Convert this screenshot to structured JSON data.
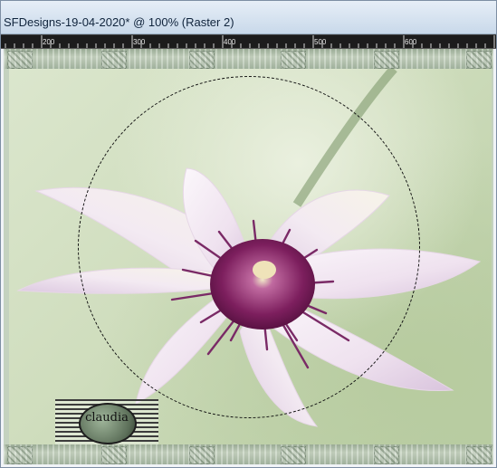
{
  "window": {
    "title": "SFDesigns-19-04-2020* @ 100% (Raster 2)"
  },
  "ruler": {
    "ticks": [
      "200",
      "300",
      "400",
      "500",
      "600"
    ]
  },
  "canvas": {
    "watermark_text": "claudia"
  },
  "colors": {
    "titlebar": "#c9d9ea",
    "ruler_bg": "#1c1c1c",
    "frame_border": "#b4c3ae",
    "petal": "#f6eef6",
    "stamen": "#8b2f6c"
  },
  "icons": {
    "selection": "circular-marquee-selection",
    "watermark": "claudia-signature-badge"
  }
}
